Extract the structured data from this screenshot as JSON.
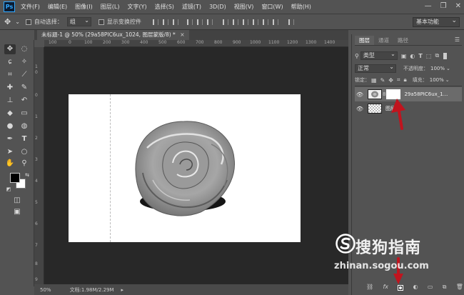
{
  "app": {
    "logo": "Ps"
  },
  "menu": [
    "文件(F)",
    "编辑(E)",
    "图像(I)",
    "图层(L)",
    "文字(Y)",
    "选择(S)",
    "滤镜(T)",
    "3D(D)",
    "视图(V)",
    "窗口(W)",
    "帮助(H)"
  ],
  "window_controls": {
    "minimize": "—",
    "restore": "❐",
    "close": "✕"
  },
  "options": {
    "auto_select_label": "自动选择：",
    "auto_select_value": "组",
    "show_transform_label": "显示变换控件",
    "workspace": "基本功能"
  },
  "document": {
    "tab_title": "未标题-1 @ 50% (29a58PIC6ux_1024, 图层蒙版/8) *",
    "tab_close": "×"
  },
  "ruler_top": [
    "100",
    "0",
    "100",
    "200",
    "300",
    "400",
    "500",
    "600",
    "700",
    "800",
    "900",
    "1000",
    "1100",
    "1200",
    "1300",
    "1400"
  ],
  "ruler_left": [
    "1",
    "0",
    "0",
    "1",
    "2",
    "3",
    "4",
    "5",
    "6",
    "7",
    "8",
    "9"
  ],
  "status": {
    "zoom": "50%",
    "doc_info": "文档:1.98M/2.29M"
  },
  "panel": {
    "tabs": [
      "图层",
      "通道",
      "路径"
    ],
    "filter_kind": "类型",
    "blend_mode": "正常",
    "opacity_label": "不透明度：",
    "opacity_value": "100%",
    "lock_label": "锁定：",
    "fill_label": "填充：",
    "fill_value": "100%",
    "layers": [
      {
        "name": "29a58PIC6ux_1...",
        "visible": true,
        "selected": true
      },
      {
        "name": "图层",
        "visible": true,
        "selected": false
      }
    ],
    "bottom_icons": [
      "link-icon",
      "fx-icon",
      "mask-icon",
      "adjustment-icon",
      "group-icon",
      "new-layer-icon",
      "trash-icon"
    ],
    "fx_label": "fx"
  },
  "watermark": {
    "brand": "搜狗指南",
    "url": "zhinan.sogou.com"
  },
  "colors": {
    "annotation_arrow": "#c0141e",
    "foreground": "#000000",
    "background": "#ffffff"
  }
}
